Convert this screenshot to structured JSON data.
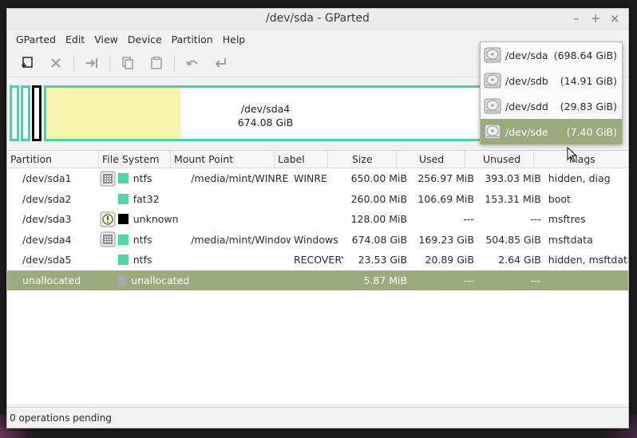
{
  "window": {
    "title": "/dev/sda - GParted",
    "min": "–",
    "max": "+",
    "close": "×"
  },
  "menu": [
    "GParted",
    "Edit",
    "View",
    "Device",
    "Partition",
    "Help"
  ],
  "diskmap": {
    "name": "/dev/sda4",
    "size": "674.08 GiB"
  },
  "devices": [
    {
      "name": "/dev/sda",
      "size": "(698.64 GiB)"
    },
    {
      "name": "/dev/sdb",
      "size": "(14.91 GiB)"
    },
    {
      "name": "/dev/sdd",
      "size": "(29.83 GiB)"
    },
    {
      "name": "/dev/sde",
      "size": "(7.40 GiB)",
      "selected": true
    }
  ],
  "columns": [
    "Partition",
    "File System",
    "Mount Point",
    "Label",
    "Size",
    "Used",
    "Unused",
    "Flags"
  ],
  "rows": [
    {
      "partition": "/dev/sda1",
      "lock": "key",
      "fs": "ntfs",
      "fs_color": "#4fd6a8",
      "mount": "/media/mint/WINRE",
      "label": "WINRE",
      "size": "650.00 MiB",
      "used": "256.97 MiB",
      "unused": "393.03 MiB",
      "flags": "hidden, diag"
    },
    {
      "partition": "/dev/sda2",
      "lock": "",
      "fs": "fat32",
      "fs_color": "#4fd6a8",
      "mount": "",
      "label": "",
      "size": "260.00 MiB",
      "used": "106.69 MiB",
      "unused": "153.31 MiB",
      "flags": "boot"
    },
    {
      "partition": "/dev/sda3",
      "lock": "warn",
      "fs": "unknown",
      "fs_color": "#000000",
      "mount": "",
      "label": "",
      "size": "128.00 MiB",
      "used": "---",
      "unused": "---",
      "flags": "msftres"
    },
    {
      "partition": "/dev/sda4",
      "lock": "key",
      "fs": "ntfs",
      "fs_color": "#4fd6a8",
      "mount": "/media/mint/Windows",
      "label": "Windows",
      "size": "674.08 GiB",
      "used": "169.23 GiB",
      "unused": "504.85 GiB",
      "flags": "msftdata"
    },
    {
      "partition": "/dev/sda5",
      "lock": "",
      "fs": "ntfs",
      "fs_color": "#4fd6a8",
      "mount": "",
      "label": "RECOVERY",
      "size": "23.53 GiB",
      "used": "20.89 GiB",
      "unused": "2.64 GiB",
      "flags": "hidden, msftdata"
    },
    {
      "partition": "unallocated",
      "lock": "",
      "fs": "unallocated",
      "fs_color": "#a8a8a8",
      "mount": "",
      "label": "",
      "size": "5.87 MiB",
      "used": "---",
      "unused": "---",
      "flags": "",
      "selected": true
    }
  ],
  "status": "0 operations pending"
}
